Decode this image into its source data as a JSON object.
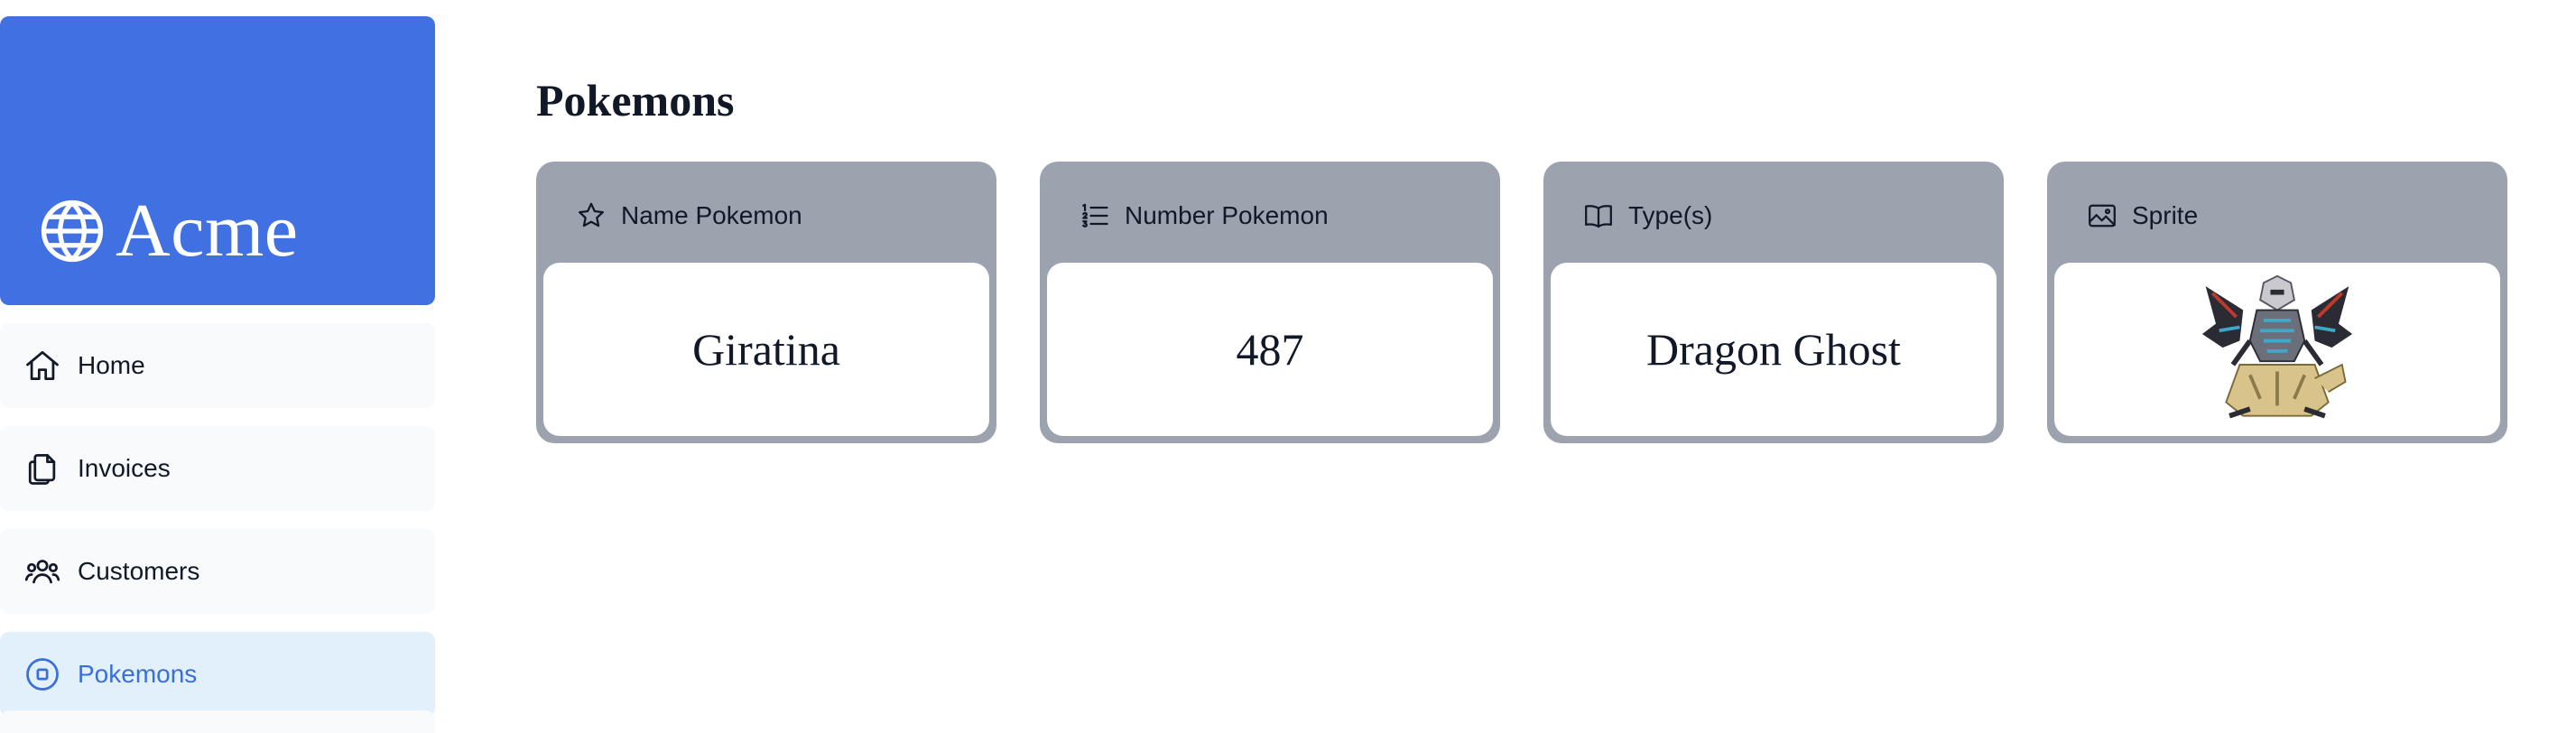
{
  "brand": {
    "name": "Acme",
    "icon": "globe-icon"
  },
  "sidebar": {
    "items": [
      {
        "label": "Home",
        "icon": "home-icon",
        "active": false
      },
      {
        "label": "Invoices",
        "icon": "documents-icon",
        "active": false
      },
      {
        "label": "Customers",
        "icon": "users-icon",
        "active": false
      },
      {
        "label": "Pokemons",
        "icon": "circle-stop-icon",
        "active": true
      }
    ]
  },
  "page": {
    "title": "Pokemons"
  },
  "cards": [
    {
      "title": "Name Pokemon",
      "icon": "star-icon",
      "value": "Giratina"
    },
    {
      "title": "Number Pokemon",
      "icon": "numbered-list-icon",
      "value": "487"
    },
    {
      "title": "Type(s)",
      "icon": "open-book-icon",
      "value": "Dragon Ghost"
    },
    {
      "title": "Sprite",
      "icon": "image-icon",
      "value": ""
    }
  ],
  "colors": {
    "brand": "#4170e3",
    "card_frame": "#9ca3af",
    "active_nav_bg": "#e2f0fb",
    "active_nav_text": "#3b6fd8",
    "nav_bg": "#f8fafc"
  }
}
